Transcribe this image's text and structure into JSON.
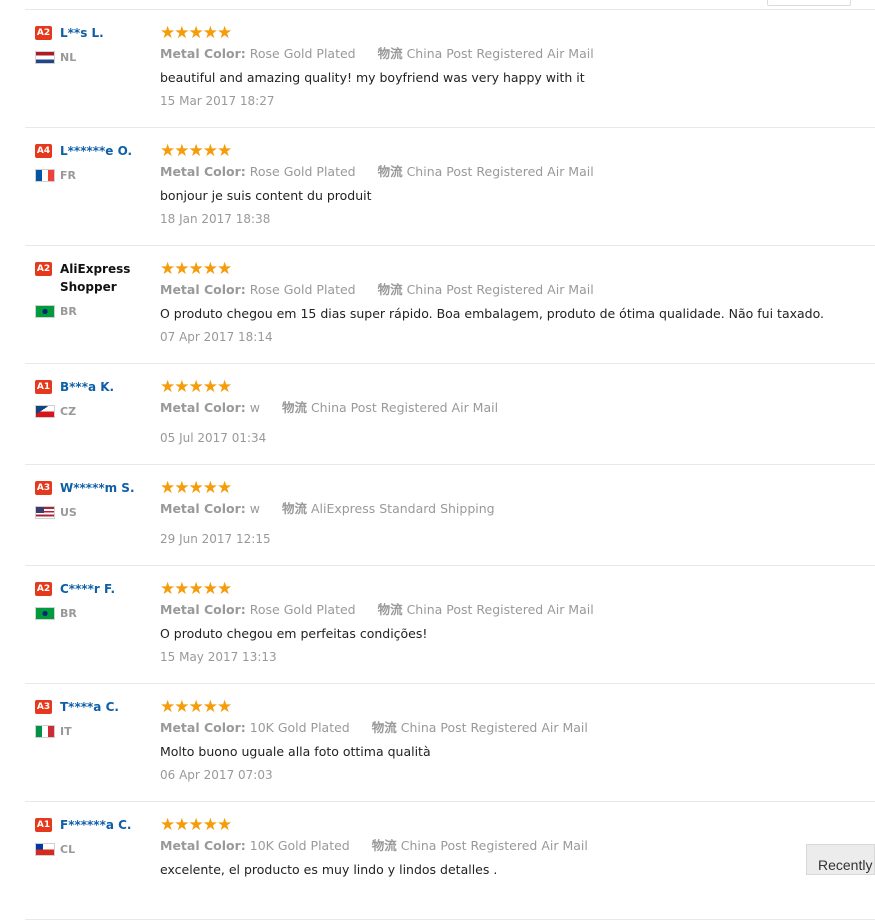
{
  "labels": {
    "metal_color": "Metal Color:",
    "logistics": "物流"
  },
  "recently_button": "Recently",
  "reviews": [
    {
      "level": "A2",
      "name": "L**s L.",
      "country": "NL",
      "flag": "nl",
      "stars": "★★★★★",
      "metal": "Rose Gold Plated",
      "shipping": "China Post Registered Air Mail",
      "text": "beautiful and amazing quality! my boyfriend was very happy with it",
      "date": "15 Mar 2017 18:27"
    },
    {
      "level": "A4",
      "name": "L******e O.",
      "country": "FR",
      "flag": "fr",
      "stars": "★★★★★",
      "metal": "Rose Gold Plated",
      "shipping": "China Post Registered Air Mail",
      "text": "bonjour je suis content du produit",
      "date": "18 Jan 2017 18:38"
    },
    {
      "level": "A2",
      "name": "AliExpress Shopper",
      "country": "BR",
      "flag": "br",
      "stars": "★★★★★",
      "metal": "Rose Gold Plated",
      "shipping": "China Post Registered Air Mail",
      "text": "O produto chegou em 15 dias super rápido. Boa embalagem, produto de ótima qualidade. Não fui taxado.",
      "date": "07 Apr 2017 18:14"
    },
    {
      "level": "A1",
      "name": "B***a K.",
      "country": "CZ",
      "flag": "cz",
      "stars": "★★★★★",
      "metal": "w",
      "shipping": "China Post Registered Air Mail",
      "text": "",
      "date": "05 Jul 2017 01:34"
    },
    {
      "level": "A3",
      "name": "W*****m S.",
      "country": "US",
      "flag": "us",
      "stars": "★★★★★",
      "metal": "w",
      "shipping": "AliExpress Standard Shipping",
      "text": "",
      "date": "29 Jun 2017 12:15"
    },
    {
      "level": "A2",
      "name": "C****r F.",
      "country": "BR",
      "flag": "br",
      "stars": "★★★★★",
      "metal": "Rose Gold Plated",
      "shipping": "China Post Registered Air Mail",
      "text": "O produto chegou em perfeitas condições!",
      "date": "15 May 2017 13:13"
    },
    {
      "level": "A3",
      "name": "T****a C.",
      "country": "IT",
      "flag": "it",
      "stars": "★★★★★",
      "metal": "10K Gold Plated",
      "shipping": "China Post Registered Air Mail",
      "text": "Molto buono uguale alla foto ottima qualità",
      "date": "06 Apr 2017 07:03"
    },
    {
      "level": "A1",
      "name": "F******a C.",
      "country": "CL",
      "flag": "cl",
      "stars": "★★★★★",
      "metal": "10K Gold Plated",
      "shipping": "China Post Registered Air Mail",
      "text": "excelente, el producto es muy lindo y lindos detalles .",
      "date": ""
    }
  ]
}
